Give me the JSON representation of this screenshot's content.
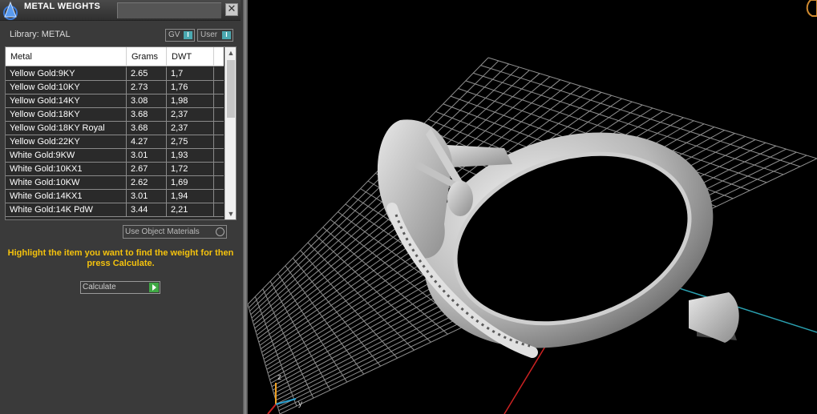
{
  "window": {
    "title": "METAL WEIGHTS",
    "close_glyph": "✕"
  },
  "library": {
    "label": "Library: METAL"
  },
  "toggles": {
    "gv": "GV",
    "user": "User",
    "indicator": "I"
  },
  "table": {
    "headers": [
      "Metal",
      "Grams",
      "DWT"
    ],
    "rows": [
      [
        "Yellow Gold:9KY",
        "2.65",
        "1,7"
      ],
      [
        "Yellow Gold:10KY",
        "2.73",
        "1,76"
      ],
      [
        "Yellow Gold:14KY",
        "3.08",
        "1,98"
      ],
      [
        "Yellow Gold:18KY",
        "3.68",
        "2,37"
      ],
      [
        "Yellow Gold:18KY Royal",
        "3.68",
        "2,37"
      ],
      [
        "Yellow Gold:22KY",
        "4.27",
        "2,75"
      ],
      [
        "White Gold:9KW",
        "3.01",
        "1,93"
      ],
      [
        "White Gold:10KX1",
        "2.67",
        "1,72"
      ],
      [
        "White Gold:10KW",
        "2.62",
        "1,69"
      ],
      [
        "White Gold:14KX1",
        "3.01",
        "1,94"
      ],
      [
        "White Gold:14K PdW",
        "3.44",
        "2,21"
      ]
    ]
  },
  "use_object_materials": "Use Object Materials",
  "instruction": "Highlight the item you want to find the weight for then press Calculate.",
  "calculate_label": "Calculate",
  "axes": {
    "z": "z",
    "y": "y"
  },
  "colors": {
    "panel_bg": "#3a3a3a",
    "instruction_text": "#f4c20d",
    "x_axis": "#cc2222",
    "y_axis": "#2aa0b0",
    "grid": "#9a9a9a"
  },
  "icons": [
    "app-logo-icon",
    "close-icon",
    "scroll-up-icon",
    "scroll-down-icon",
    "play-arrow-icon"
  ]
}
